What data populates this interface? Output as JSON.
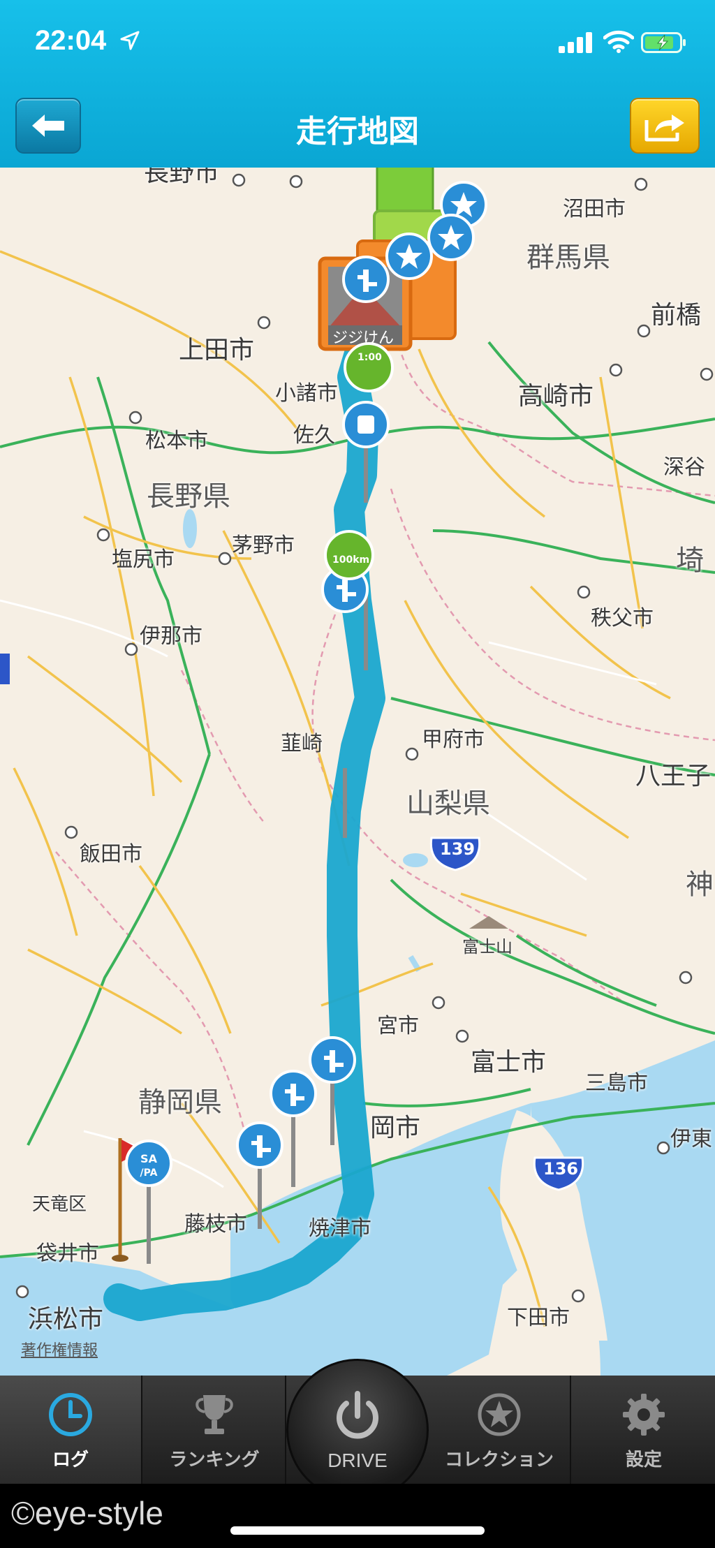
{
  "status_bar": {
    "time": "22:04"
  },
  "header": {
    "title": "走行地図"
  },
  "map": {
    "labels": {
      "nagano_shi": "長野市",
      "numata": "沼田市",
      "gunma": "群馬県",
      "maebashi": "前橋",
      "ueda": "上田市",
      "komoro": "小諸市",
      "takasaki": "高崎市",
      "matsumoto": "松本市",
      "saku": "佐久",
      "fukaya": "深谷",
      "nagano_ken": "長野県",
      "saitama": "埼",
      "shiojiri": "塩尻市",
      "chino": "茅野市",
      "chichibu": "秩父市",
      "ina": "伊那市",
      "nirasaki": "韮崎",
      "kofu": "甲府市",
      "hachioji": "八王子",
      "yamanashi": "山梨県",
      "route_139": "139",
      "iida": "飯田市",
      "kana": "神",
      "fuji_san": "富士山",
      "miyashi": "宮市",
      "fuji_shi": "富士市",
      "mishima": "三島市",
      "shizuoka_ken": "静岡県",
      "oka_shi": "岡市",
      "ito": "伊東",
      "route_136": "136",
      "tenryu": "天竜区",
      "fujieda": "藤枝市",
      "yaizu": "焼津市",
      "fukuroi": "袋井市",
      "hamamatsu": "浜松市",
      "shimoda": "下田市",
      "jijiken": "ジジけん",
      "marker_1hour": "1:00",
      "marker_100km": "100km"
    },
    "copyright": "著作権情報"
  },
  "tabs": {
    "log": "ログ",
    "ranking": "ランキング",
    "drive": "DRIVE",
    "collection": "コレクション",
    "settings": "設定"
  },
  "watermark": "©eye-style",
  "colors": {
    "header": "#17c0ea",
    "route": "#1aa6cf",
    "share": "#f5c10a"
  }
}
